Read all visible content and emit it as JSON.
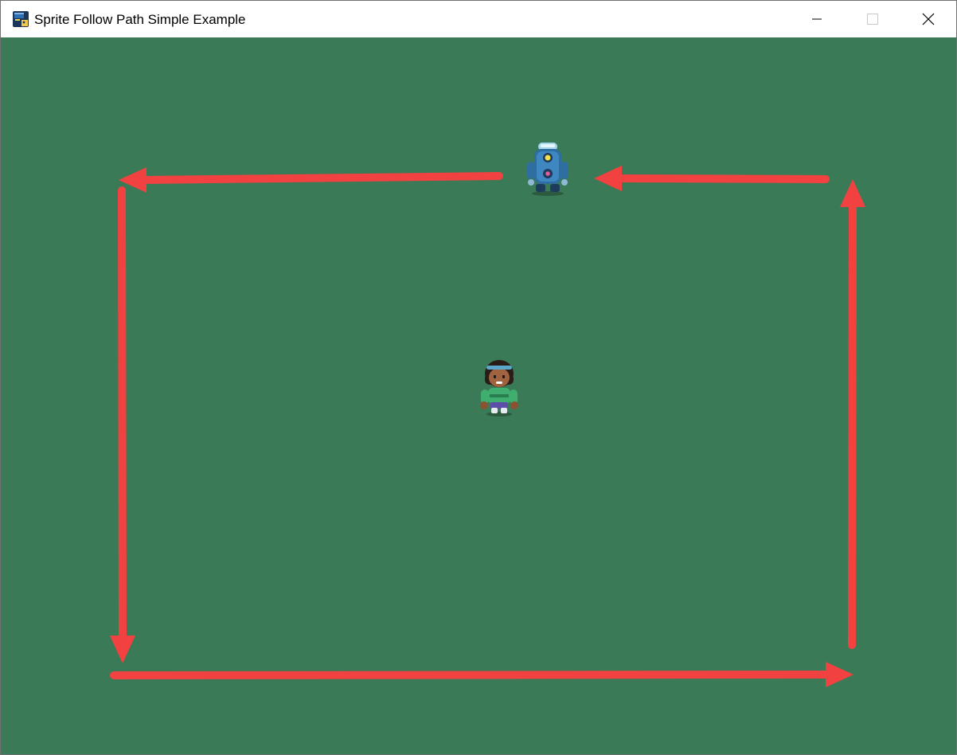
{
  "window": {
    "title": "Sprite Follow Path Simple Example",
    "controls": {
      "minimize": "minimize",
      "maximize": "maximize",
      "close": "close"
    }
  },
  "scene": {
    "background_color": "#3a7a56",
    "arrow_color": "#f24141",
    "sprites": [
      {
        "name": "robot-enemy",
        "icon": "robot-sprite"
      },
      {
        "name": "player-girl",
        "icon": "girl-sprite"
      }
    ]
  }
}
